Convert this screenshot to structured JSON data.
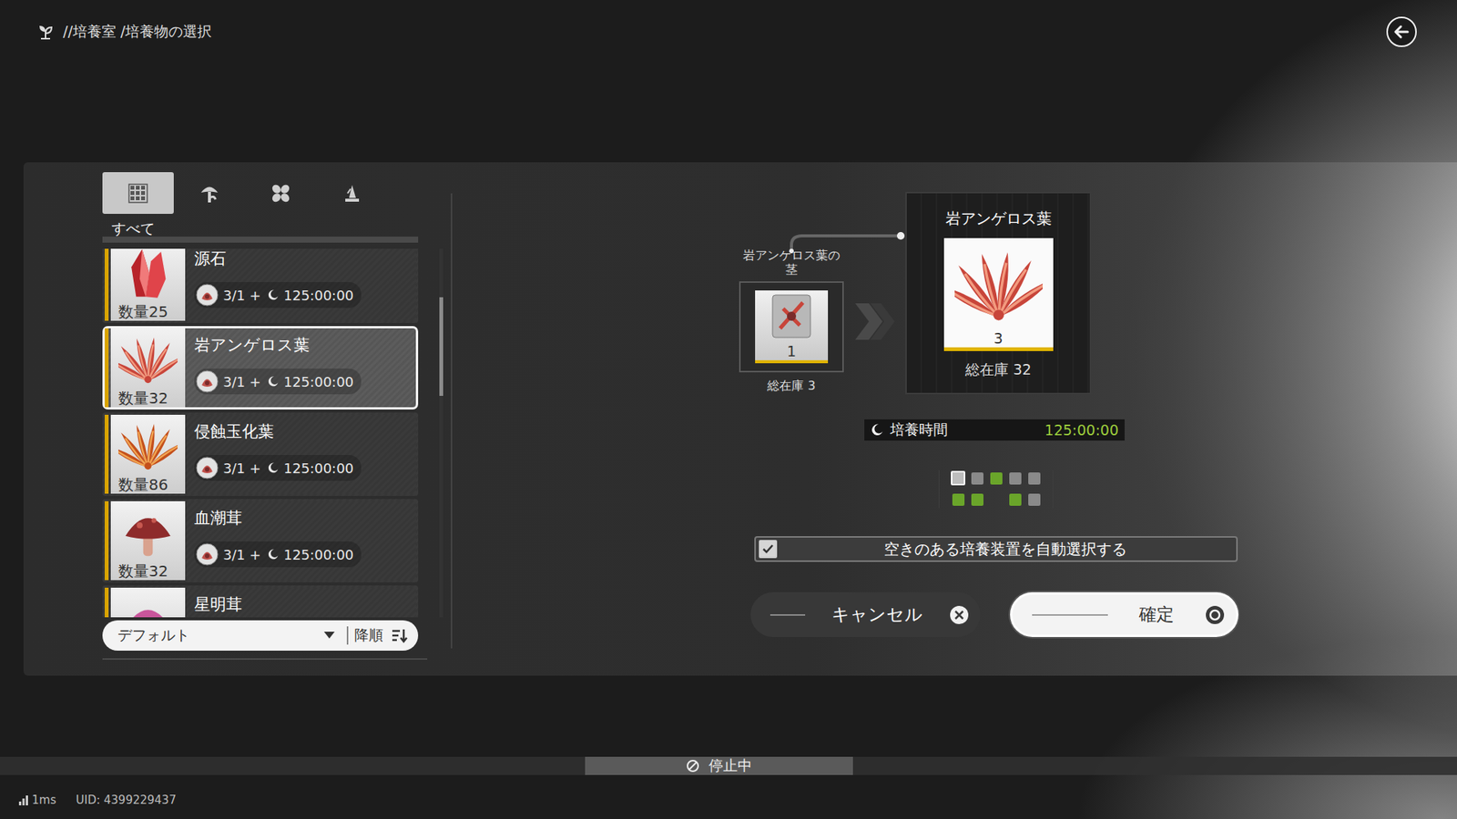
{
  "breadcrumb": "//培養室 /培養物の選択",
  "filter_tabs": [
    {
      "kind": "all",
      "selected": true
    },
    {
      "kind": "plant",
      "selected": false
    },
    {
      "kind": "flower",
      "selected": false
    },
    {
      "kind": "mineral",
      "selected": false
    }
  ],
  "category_label": "すべて",
  "items": [
    {
      "name": "源石",
      "quantity": "数量25",
      "seeds": "3/1 +",
      "time": "125:00:00",
      "kind": "crystal",
      "selected": false
    },
    {
      "name": "岩アンゲロス葉",
      "quantity": "数量32",
      "seeds": "3/1 +",
      "time": "125:00:00",
      "kind": "leaf",
      "selected": true
    },
    {
      "name": "侵蝕玉化葉",
      "quantity": "数量86",
      "seeds": "3/1 +",
      "time": "125:00:00",
      "kind": "jade",
      "selected": false
    },
    {
      "name": "血潮茸",
      "quantity": "数量32",
      "seeds": "3/1 +",
      "time": "125:00:00",
      "kind": "mushroom",
      "selected": false
    },
    {
      "name": "星明茸",
      "kind": "bloom",
      "selected": false
    }
  ],
  "list_scroll": {
    "level": 0.18
  },
  "sort": {
    "field": "デフォルト",
    "order": "降順"
  },
  "recipe": {
    "seed": {
      "name": "岩アンゲロス葉の茎",
      "count": "1",
      "stock": "総在庫 3"
    },
    "product": {
      "name": "岩アンゲロス葉",
      "count": "3",
      "stock": "総在庫 32"
    }
  },
  "time": {
    "label": "培養時間",
    "value": "125:00:00"
  },
  "slots": [
    {
      "kind": "selected"
    },
    {
      "kind": "free"
    },
    {
      "kind": "busy"
    },
    {
      "kind": "free"
    },
    {
      "kind": "free"
    },
    {
      "kind": "busy"
    },
    {
      "kind": "busy"
    },
    {
      "kind": "none"
    },
    {
      "kind": "busy"
    },
    {
      "kind": "free"
    }
  ],
  "auto_select": {
    "label": "空きのある培養装置を自動選択する",
    "checked": true
  },
  "buttons": [
    {
      "label": "キャンセル",
      "kind": "cancel"
    },
    {
      "label": "確定",
      "kind": "confirm"
    }
  ],
  "status_bar": {
    "state": "停止中"
  },
  "footer": {
    "ping": "1ms",
    "uid": "UID: 4399229437"
  }
}
